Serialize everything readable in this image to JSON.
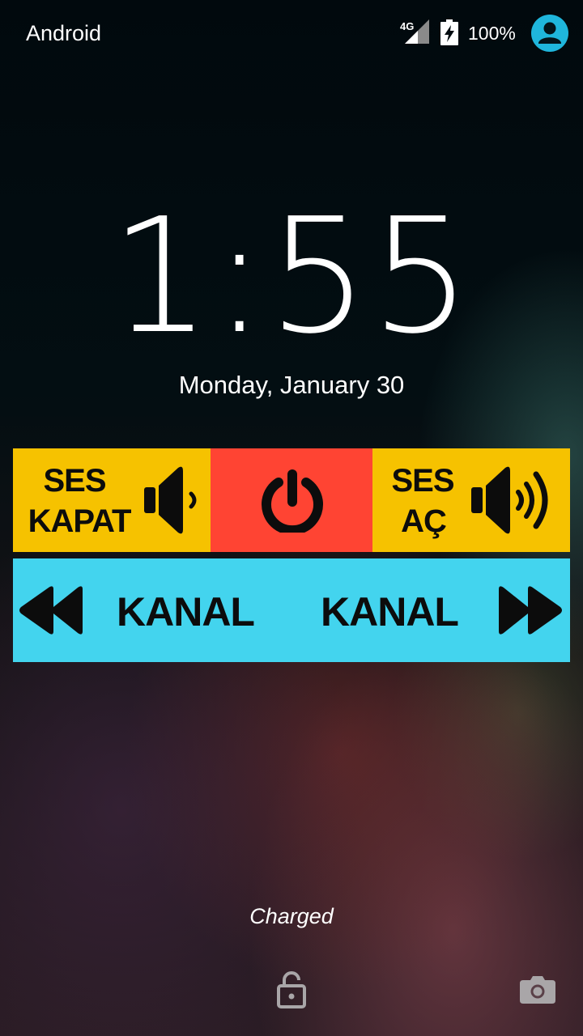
{
  "status_bar": {
    "carrier": "Android",
    "network_type": "4G",
    "battery_percent": "100%",
    "icons": [
      "signal-4g-icon",
      "battery-charging-icon",
      "user-avatar-icon"
    ]
  },
  "lockscreen": {
    "time_hours": "1",
    "time_minutes": "55",
    "date": "Monday, January 30",
    "charging_status": "Charged"
  },
  "widget": {
    "mute": {
      "line1": "SES",
      "line2": "KAPAT",
      "icon": "speaker-low-icon",
      "color": "#f6c200"
    },
    "power": {
      "icon": "power-icon",
      "color": "#ff4433"
    },
    "volume_up": {
      "line1": "SES",
      "line2": "AÇ",
      "icon": "speaker-high-icon",
      "color": "#f6c200"
    },
    "channel": {
      "prev_label": "KANAL",
      "next_label": "KANAL",
      "prev_icon": "rewind-icon",
      "next_icon": "fast-forward-icon",
      "color": "#43d4ee"
    }
  },
  "bottom_bar": {
    "left_icon": "unlock-icon",
    "right_icon": "camera-icon"
  },
  "colors": {
    "text": "#ffffff",
    "icon_dark": "#0c0c0c",
    "avatar": "#1fb6dc",
    "bottom_icons": "#a9a6a8"
  }
}
